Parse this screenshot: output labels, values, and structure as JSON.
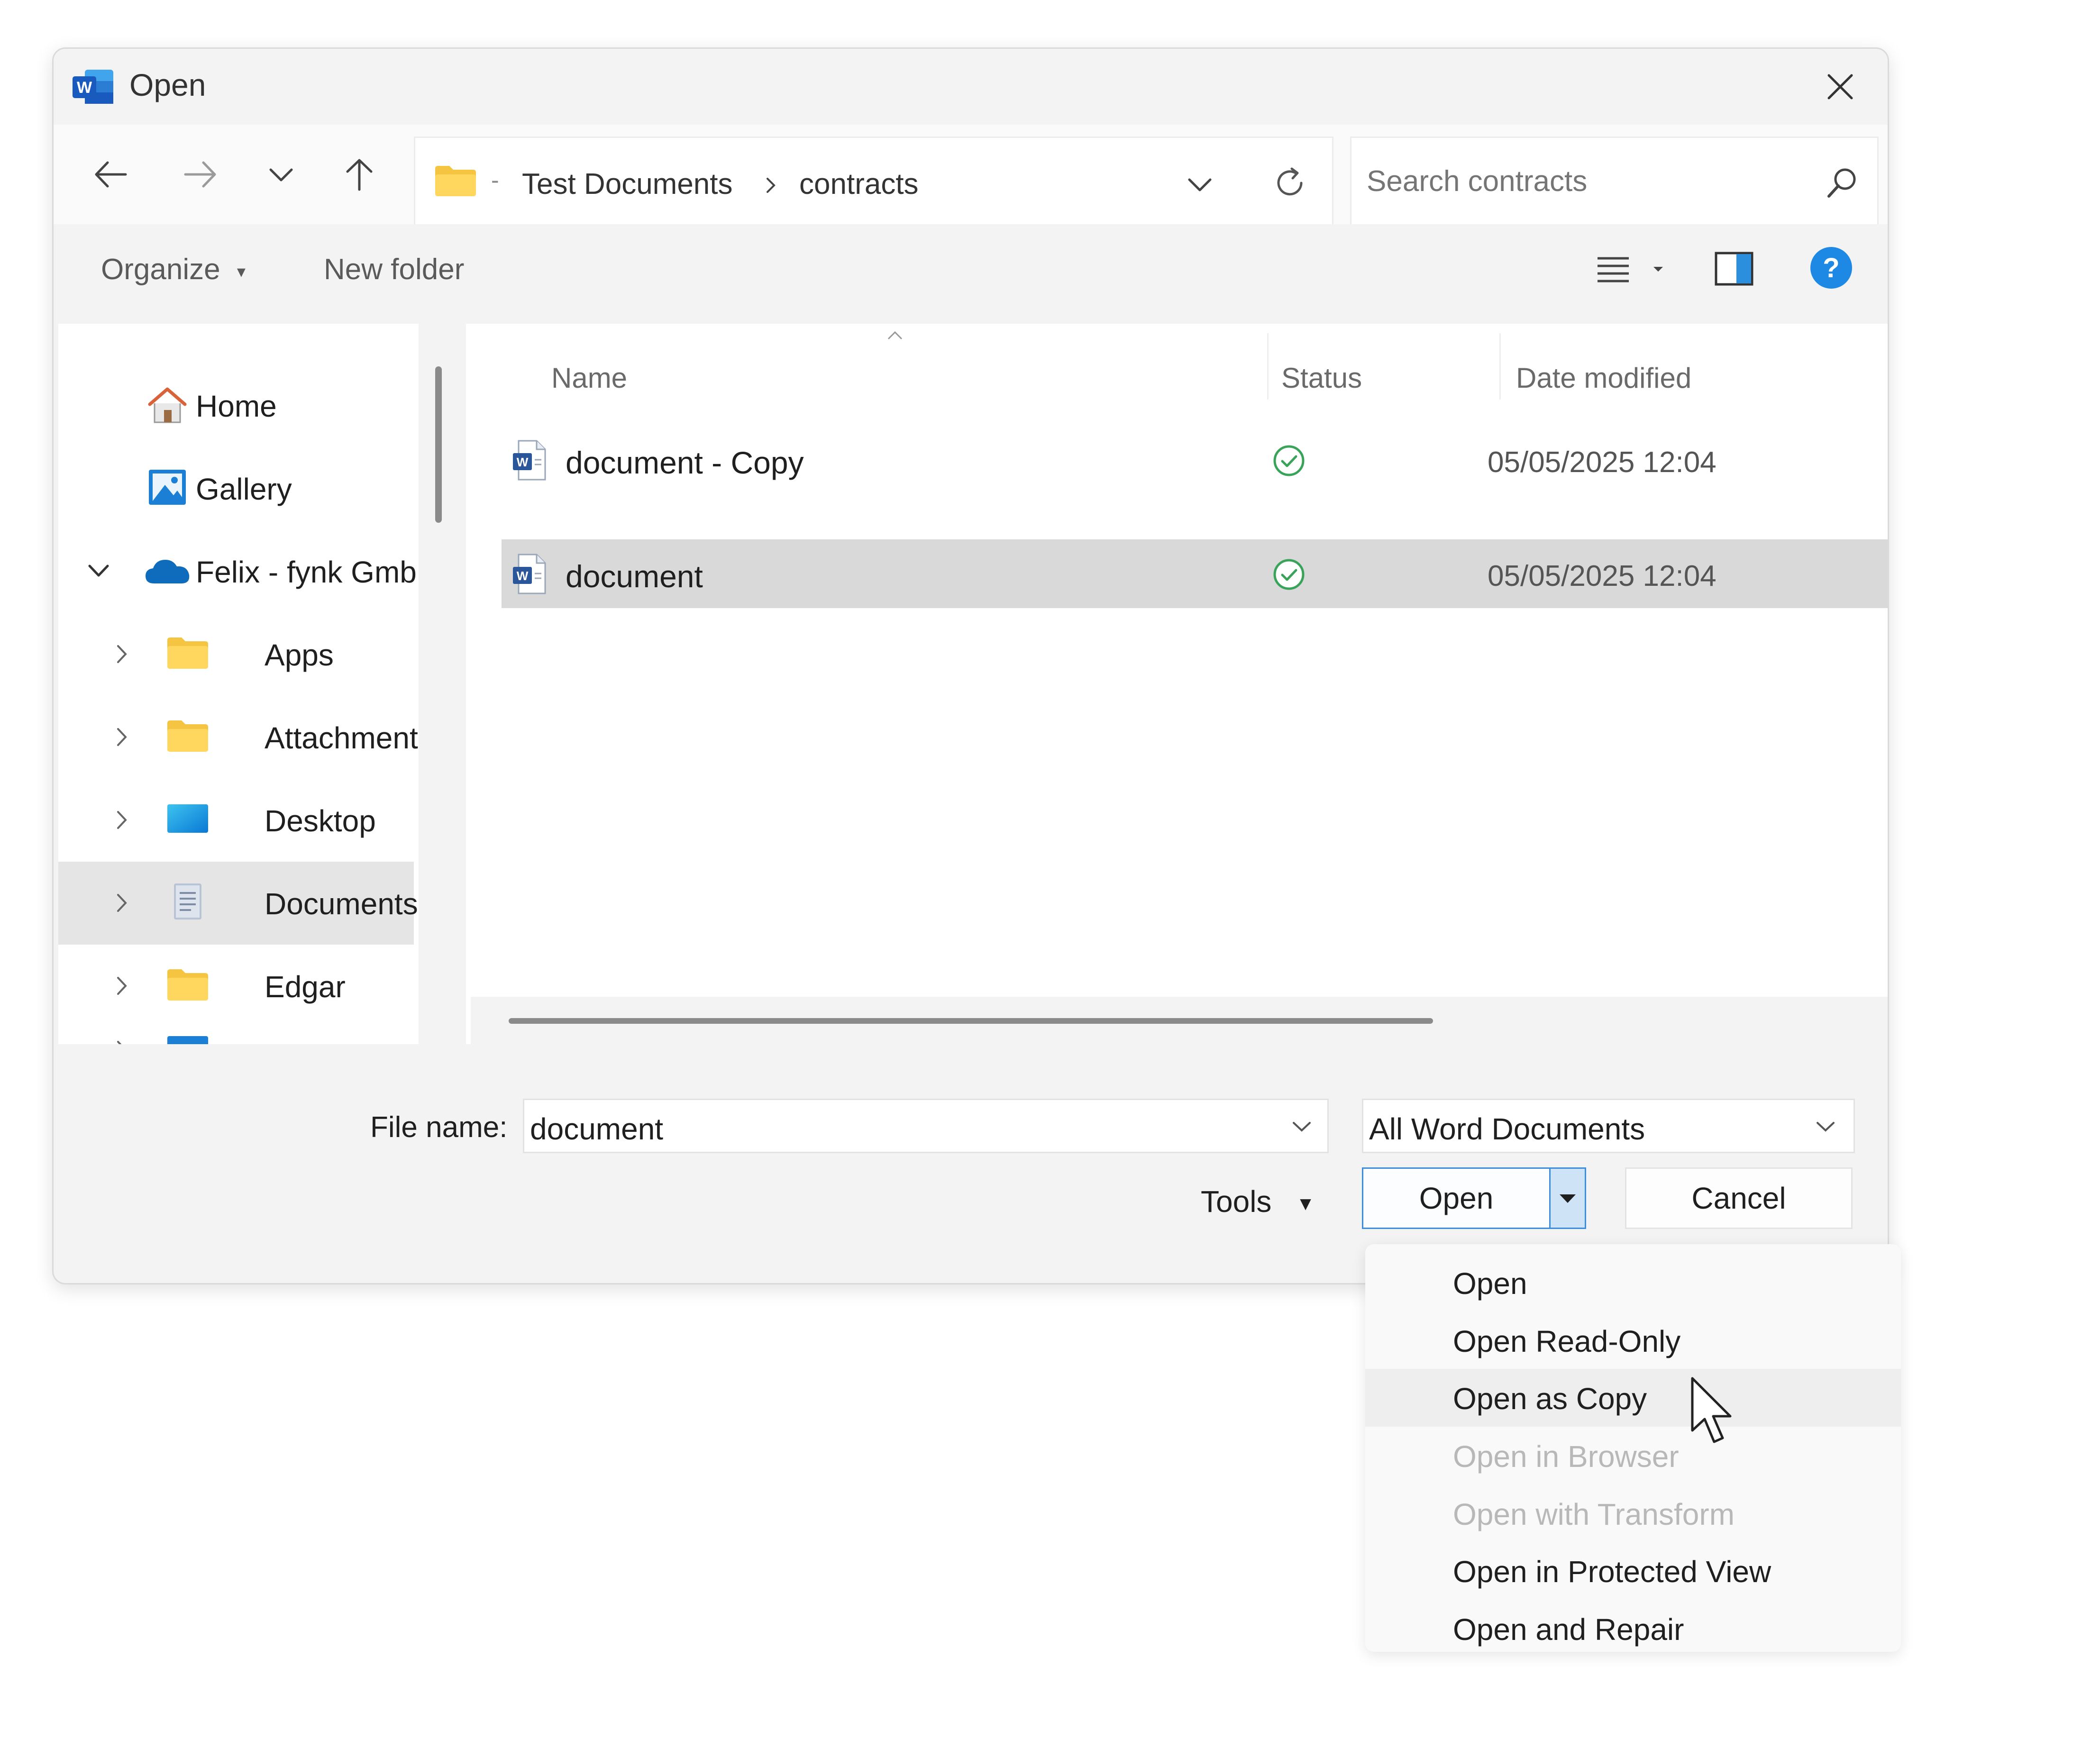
{
  "window": {
    "title": "Open"
  },
  "address": {
    "crumbs": [
      "Test Documents",
      "contracts"
    ]
  },
  "search": {
    "placeholder": "Search contracts"
  },
  "commands": {
    "organize": "Organize",
    "new_folder": "New folder"
  },
  "sidebar": {
    "items": [
      {
        "label": "Home",
        "icon": "home-icon"
      },
      {
        "label": "Gallery",
        "icon": "gallery-icon"
      },
      {
        "label": "Felix - fynk Gmb",
        "icon": "onedrive-cloud-icon"
      },
      {
        "label": "Apps",
        "icon": "folder-icon"
      },
      {
        "label": "Attachments",
        "icon": "folder-icon"
      },
      {
        "label": "Desktop",
        "icon": "desktop-icon"
      },
      {
        "label": "Documents",
        "icon": "documents-icon"
      },
      {
        "label": "Edgar",
        "icon": "folder-icon"
      }
    ]
  },
  "file_list": {
    "columns": [
      "Name",
      "Status",
      "Date modified"
    ],
    "rows": [
      {
        "name": "document - Copy",
        "date": "05/05/2025 12:04"
      },
      {
        "name": "document",
        "date": "05/05/2025 12:04"
      }
    ]
  },
  "bottom": {
    "file_name_label": "File name:",
    "file_name_value": "document",
    "file_type": "All Word Documents",
    "tools_label": "Tools",
    "open_label": "Open",
    "cancel_label": "Cancel"
  },
  "open_menu": {
    "items": [
      {
        "label": "Open"
      },
      {
        "label": "Open Read-Only"
      },
      {
        "label": "Open as Copy"
      },
      {
        "label": "Open in Browser"
      },
      {
        "label": "Open with Transform"
      },
      {
        "label": "Open in Protected View"
      },
      {
        "label": "Open and Repair"
      }
    ]
  },
  "colors": {
    "accent": "#0078d4",
    "status_ok": "#3aa35a",
    "word_blue": "#2b579a"
  }
}
